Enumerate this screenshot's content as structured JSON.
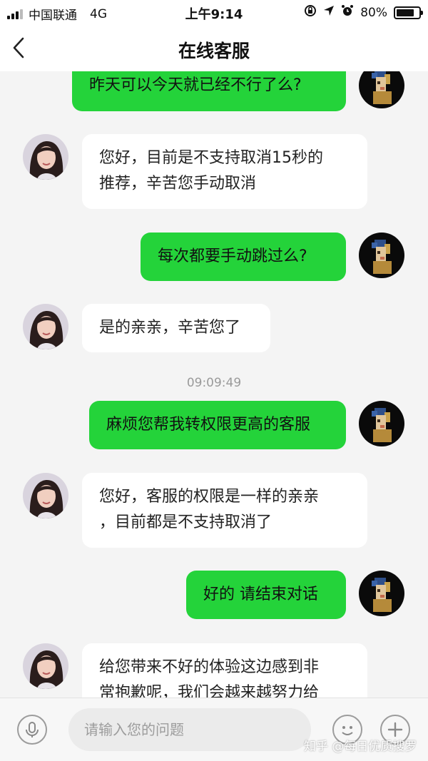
{
  "status_bar": {
    "carrier": "中国联通",
    "network": "4G",
    "time": "上午9:14",
    "battery": "80%",
    "battery_level": 0.8
  },
  "header": {
    "title": "在线客服",
    "back_icon": "chevron-left-icon"
  },
  "chat": {
    "messages": [
      {
        "from": "user",
        "text": "昨天可以今天就已经不行了么?"
      },
      {
        "from": "agent",
        "lines": [
          "您好，目前是不支持取消15秒的",
          "推荐，辛苦您手动取消"
        ]
      },
      {
        "from": "user",
        "text": "每次都要手动跳过么?"
      },
      {
        "from": "agent",
        "text": "是的亲亲，辛苦您了"
      },
      {
        "type": "timestamp",
        "text": "09:09:49"
      },
      {
        "from": "user",
        "text": "麻烦您帮我转权限更高的客服"
      },
      {
        "from": "agent",
        "lines": [
          "您好，客服的权限是一样的亲亲",
          "，目前都是不支持取消了"
        ]
      },
      {
        "from": "user",
        "text": "好的 请结束对话"
      },
      {
        "from": "agent",
        "lines": [
          "给您带来不好的体验这边感到非",
          "常抱歉呢，我们会越来越努力给"
        ]
      }
    ]
  },
  "input_bar": {
    "placeholder": "请输入您的问题",
    "icons": [
      "microphone-icon",
      "emoji-icon",
      "plus-icon"
    ]
  },
  "watermark": "知乎 @每日优质搜罗",
  "colors": {
    "user_bubble": "#24d33a",
    "agent_bubble": "#ffffff",
    "background": "#f4f4f4"
  }
}
